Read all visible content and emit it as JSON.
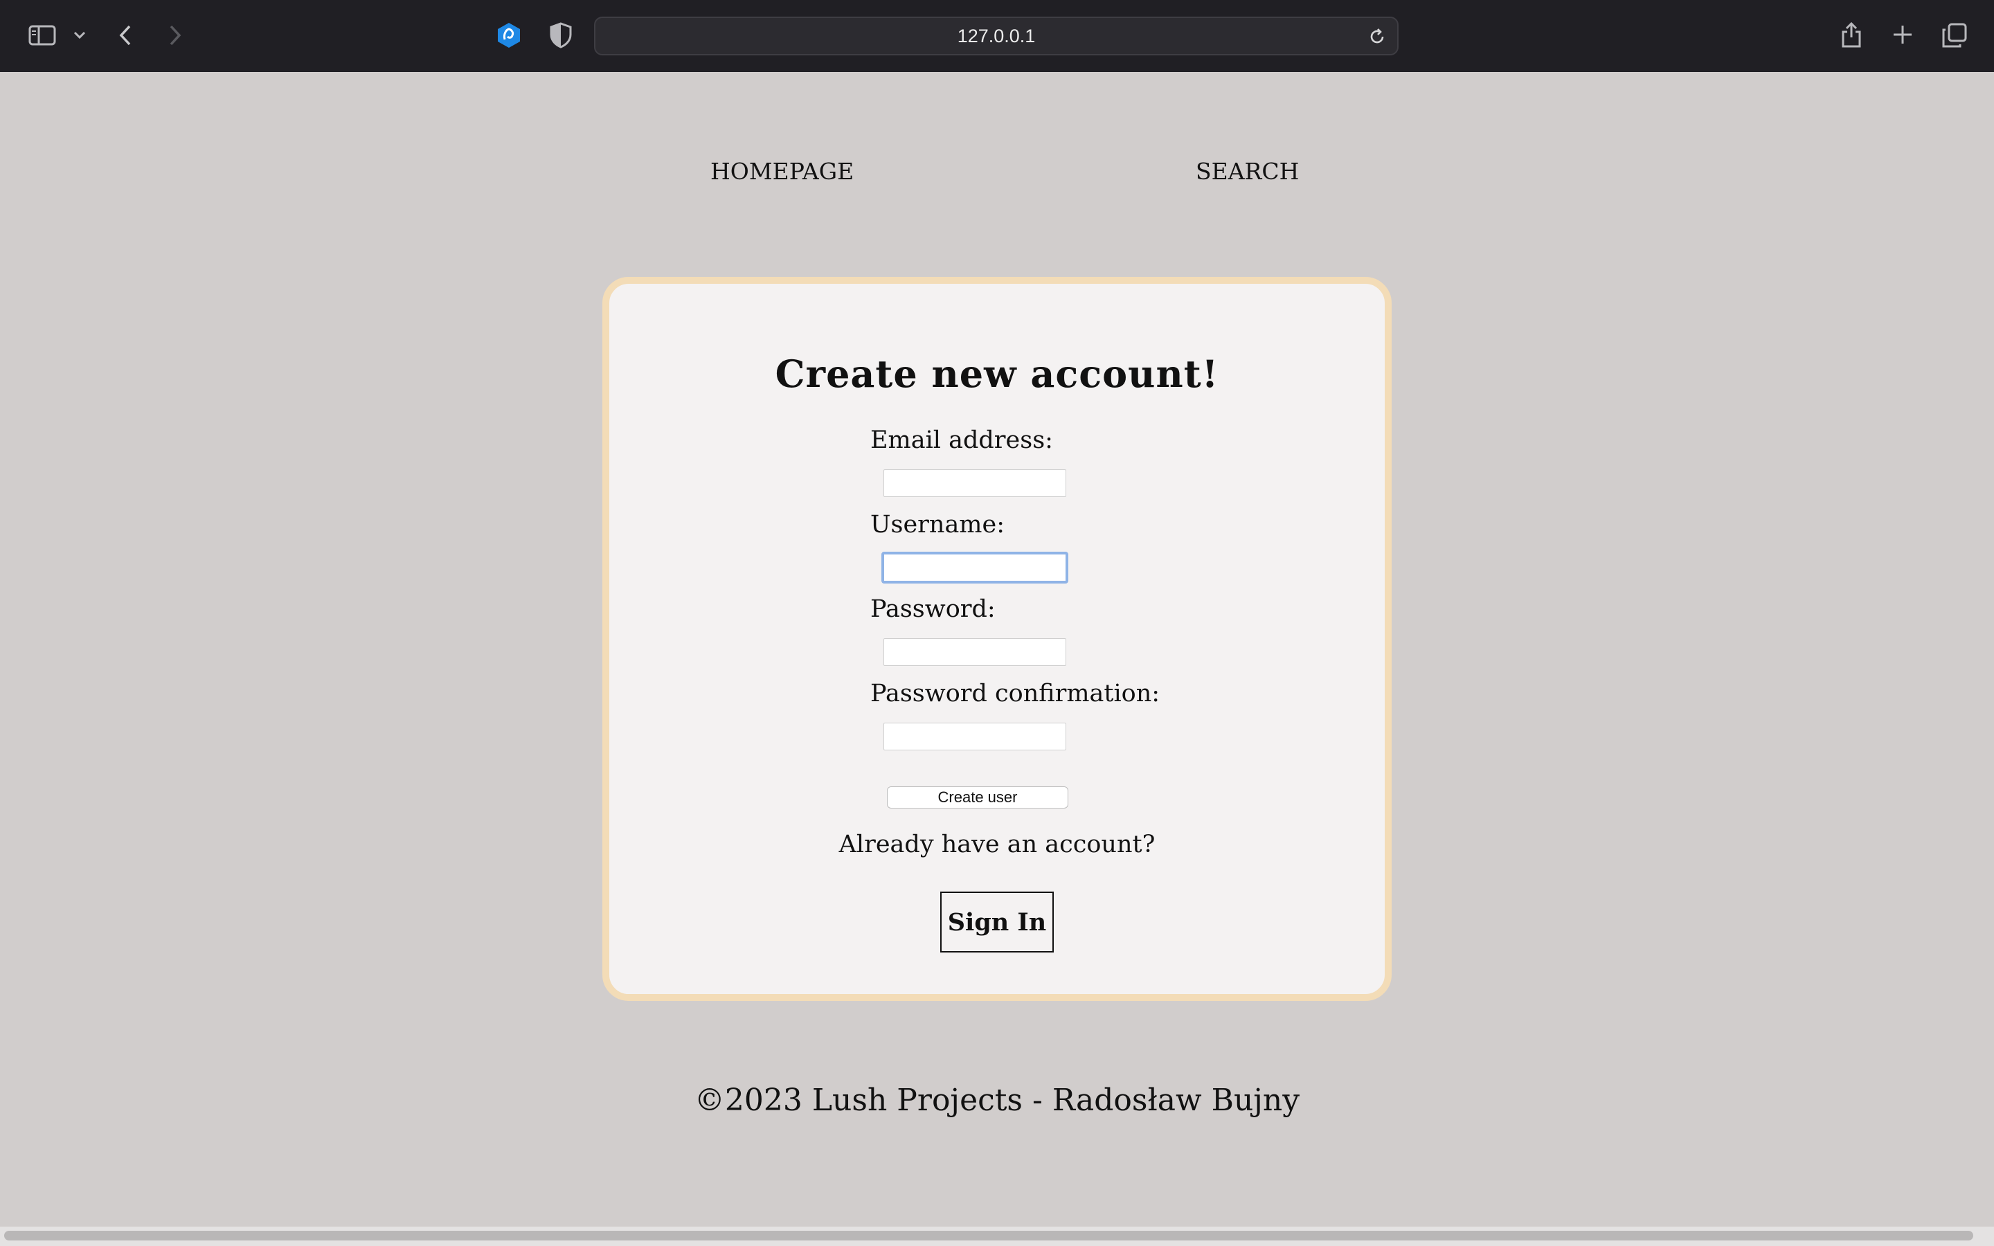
{
  "browser": {
    "url": "127.0.0.1",
    "icons": [
      "sidebar-icon",
      "chevron-down-icon",
      "back-icon",
      "forward-icon",
      "extension-icon",
      "shield-icon",
      "reload-icon",
      "share-icon",
      "new-tab-icon",
      "tabs-overview-icon"
    ]
  },
  "nav": {
    "homepage": "HOMEPAGE",
    "search": "SEARCH"
  },
  "form": {
    "title": "Create new account!",
    "email_label": "Email address:",
    "username_label": "Username:",
    "password_label": "Password:",
    "password_confirm_label": "Password confirmation:",
    "email_value": "",
    "username_value": "",
    "password_value": "",
    "password_confirm_value": "",
    "submit_label": "Create user",
    "already_text": "Already have an account?",
    "signin_label": "Sign In"
  },
  "footer": {
    "text": "©2023  Lush Projects - Radosław Bujny"
  },
  "colors": {
    "page_bg": "#d1cdcc",
    "card_bg": "#f4f2f2",
    "card_border": "#f3dcb7",
    "focus_ring": "#8fb3e6"
  }
}
